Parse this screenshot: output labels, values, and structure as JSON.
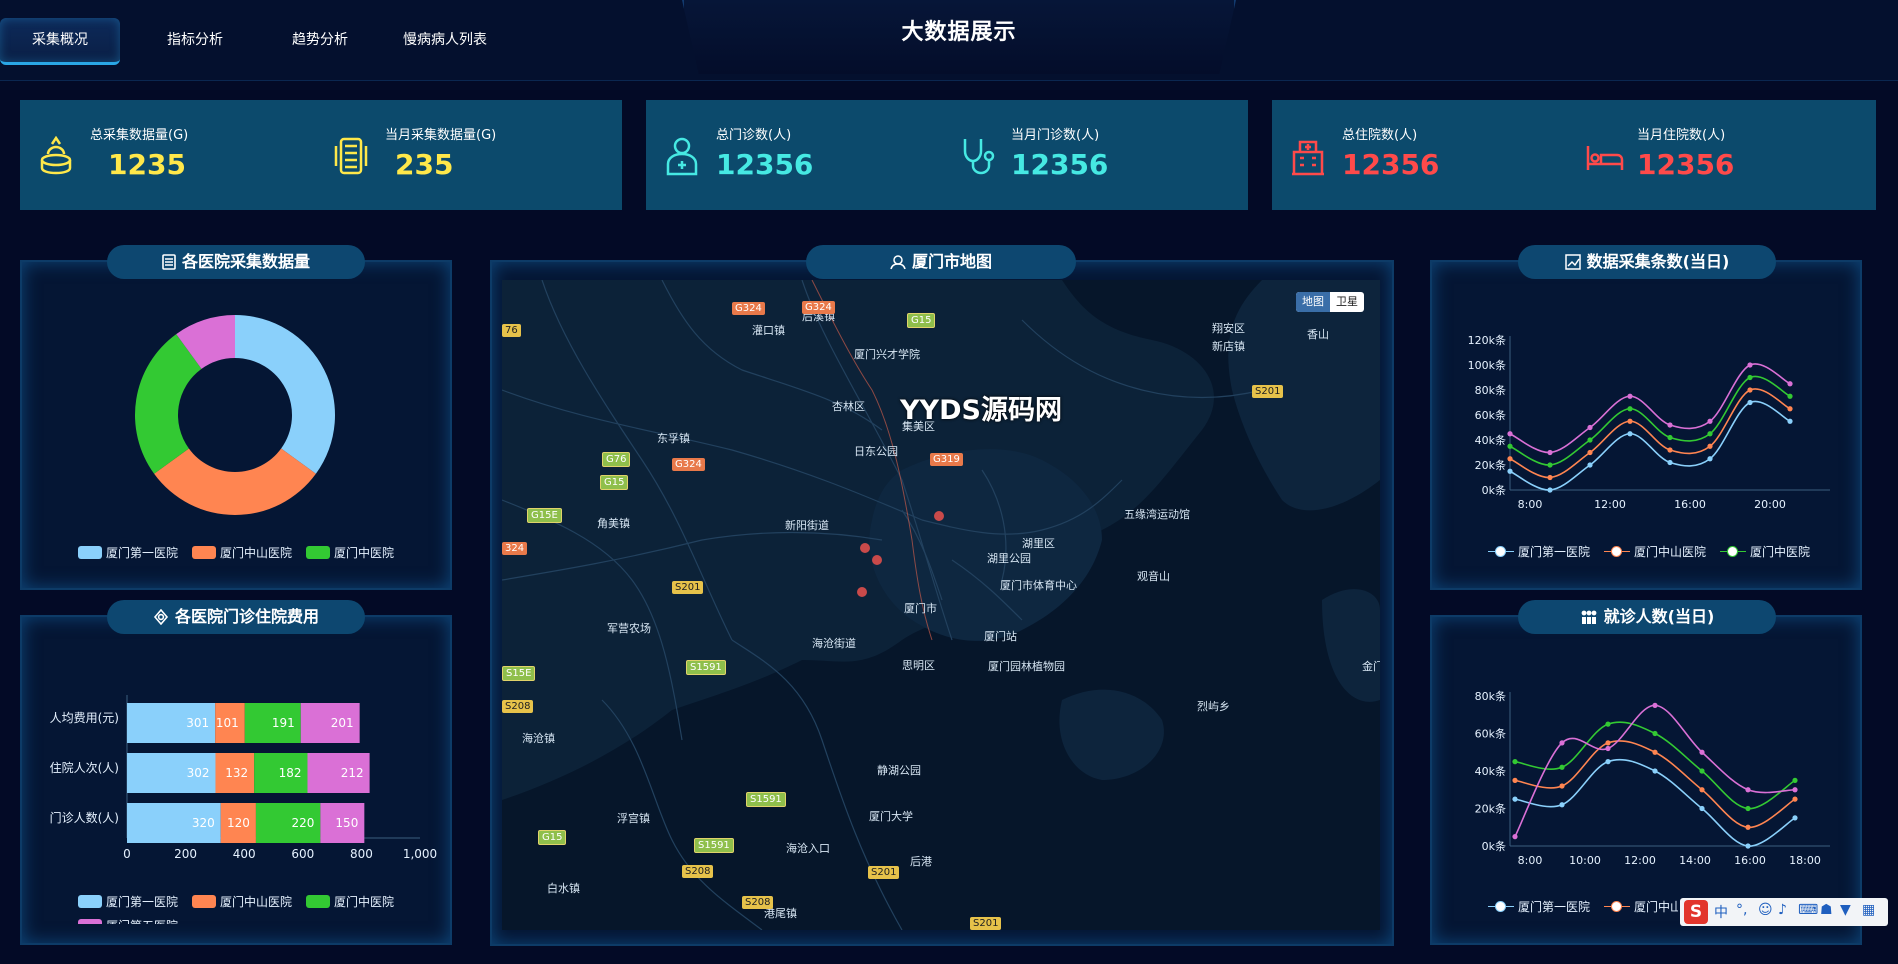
{
  "nav": {
    "tabs": [
      "采集概况",
      "指标分析",
      "趋势分析",
      "慢病病人列表"
    ],
    "active": 0
  },
  "page_title": "大数据展示",
  "stats": [
    {
      "label": "总采集数据量(G)",
      "value": "1235",
      "color": "#ffe84a",
      "icon": "database-icon"
    },
    {
      "label": "当月采集数据量(G)",
      "value": "235",
      "color": "#ffe84a",
      "icon": "server-icon"
    },
    {
      "label": "总门诊数(人)",
      "value": "12356",
      "color": "#46e9e3",
      "icon": "doctor-icon"
    },
    {
      "label": "当月门诊数(人)",
      "value": "12356",
      "color": "#46e9e3",
      "icon": "stethoscope-icon"
    },
    {
      "label": "总住院数(人)",
      "value": "12356",
      "color": "#ff4a4a",
      "icon": "hospital-icon"
    },
    {
      "label": "当月住院数(人)",
      "value": "12356",
      "color": "#ff4a4a",
      "icon": "bed-icon"
    }
  ],
  "panels": {
    "donut_title": "各医院采集数据量",
    "bar_title": "各医院门诊住院费用",
    "map_title": "厦门市地图",
    "line1_title": "数据采集条数(当日)",
    "line2_title": "就诊人数(当日)"
  },
  "colors": {
    "h1": "#8ad0fb",
    "h2": "#ff8551",
    "h3": "#33c933",
    "h4": "#da70d6"
  },
  "chart_data": [
    {
      "type": "pie",
      "title": "各医院采集数据量",
      "labels": [
        "厦门第一医院",
        "厦门中山医院",
        "厦门中医院",
        "厦门第五医院"
      ],
      "values": [
        35,
        30,
        25,
        10
      ],
      "legend": [
        "厦门第一医院",
        "厦门中山医院",
        "厦门中医院"
      ]
    },
    {
      "type": "bar",
      "title": "各医院门诊住院费用",
      "orientation": "horizontal",
      "stacked": true,
      "categories": [
        "门诊人数(人)",
        "住院人次(人)",
        "人均费用(元)"
      ],
      "series": [
        {
          "name": "厦门第一医院",
          "values": [
            320,
            302,
            301
          ]
        },
        {
          "name": "厦门中山医院",
          "values": [
            120,
            132,
            101
          ]
        },
        {
          "name": "厦门中医院",
          "values": [
            220,
            182,
            191
          ]
        },
        {
          "name": "厦门第五医院",
          "values": [
            150,
            212,
            201
          ]
        }
      ],
      "xlim": [
        0,
        1000
      ],
      "xticks": [
        "0",
        "200",
        "400",
        "600",
        "800",
        "1,000"
      ],
      "legend": [
        "厦门第一医院",
        "厦门中山医院",
        "厦门中医院",
        "厦门第五医院"
      ]
    },
    {
      "type": "line",
      "title": "数据采集条数(当日)",
      "x": [
        "8:00",
        "10:00",
        "12:00",
        "14:00",
        "16:00",
        "18:00",
        "20:00",
        "22:00"
      ],
      "xticks": [
        "8:00",
        "12:00",
        "16:00",
        "20:00"
      ],
      "series": [
        {
          "name": "厦门第一医院",
          "values": [
            15,
            0,
            20,
            45,
            22,
            25,
            70,
            55
          ]
        },
        {
          "name": "厦门中山医院",
          "values": [
            25,
            10,
            30,
            55,
            32,
            35,
            80,
            65
          ]
        },
        {
          "name": "厦门中医院",
          "values": [
            35,
            20,
            40,
            65,
            42,
            45,
            90,
            75
          ]
        },
        {
          "name": "厦门第五医院",
          "values": [
            45,
            30,
            50,
            75,
            52,
            55,
            100,
            85
          ]
        }
      ],
      "ylim": [
        0,
        120
      ],
      "yticks": [
        "0k条",
        "20k条",
        "40k条",
        "60k条",
        "80k条",
        "100k条",
        "120k条"
      ],
      "legend": [
        "厦门第一医院",
        "厦门中山医院",
        "厦门中医院"
      ]
    },
    {
      "type": "line",
      "title": "就诊人数(当日)",
      "x": [
        "7:00",
        "9:00",
        "11:00",
        "12:00",
        "13:00",
        "15:00",
        "17:00",
        "19:00"
      ],
      "xticks": [
        "8:00",
        "10:00",
        "12:00",
        "14:00",
        "16:00",
        "18:00"
      ],
      "series": [
        {
          "name": "厦门第一医院",
          "values": [
            25,
            22,
            45,
            40,
            20,
            0,
            15
          ]
        },
        {
          "name": "厦门中山医院",
          "values": [
            35,
            32,
            55,
            50,
            30,
            10,
            25
          ]
        },
        {
          "name": "厦门中医院",
          "values": [
            45,
            42,
            65,
            60,
            40,
            20,
            35
          ]
        },
        {
          "name": "厦门第五医院",
          "values": [
            5,
            55,
            52,
            75,
            50,
            30,
            30
          ]
        }
      ],
      "ylim": [
        0,
        80
      ],
      "yticks": [
        "0k条",
        "20k条",
        "40k条",
        "60k条",
        "80k条"
      ],
      "legend": [
        "厦门第一医院",
        "厦门中山医"
      ]
    }
  ],
  "map": {
    "toggle": [
      "地图",
      "卫星"
    ],
    "watermark": "YYDS源码网",
    "places": [
      "灌口镇",
      "后溪镇",
      "厦门兴才学院",
      "东孚镇",
      "杏林区",
      "集美区",
      "日东公园",
      "新阳街道",
      "角美镇",
      "湖里区",
      "湖里公园",
      "厦门市体育中心",
      "五缘湾运动馆",
      "观音山",
      "厦门市",
      "厦门站",
      "思明区",
      "厦门园林植物园",
      "海沧街道",
      "军营农场",
      "海沧镇",
      "静湖公园",
      "厦门大学",
      "浮宫镇",
      "海沧入口",
      "白水镇",
      "港尾镇",
      "后港",
      "翔安区",
      "新店镇",
      "香山",
      "金门",
      "烈屿乡"
    ],
    "roads": [
      "G324",
      "G324",
      "G15",
      "G76",
      "G324",
      "G15",
      "G319",
      "G15E",
      "S201",
      "S201",
      "S1591",
      "S15E",
      "S1591",
      "S208",
      "G15",
      "S1591",
      "S208",
      "S201",
      "S208",
      "S201",
      "76",
      "324"
    ]
  },
  "ime": "中"
}
